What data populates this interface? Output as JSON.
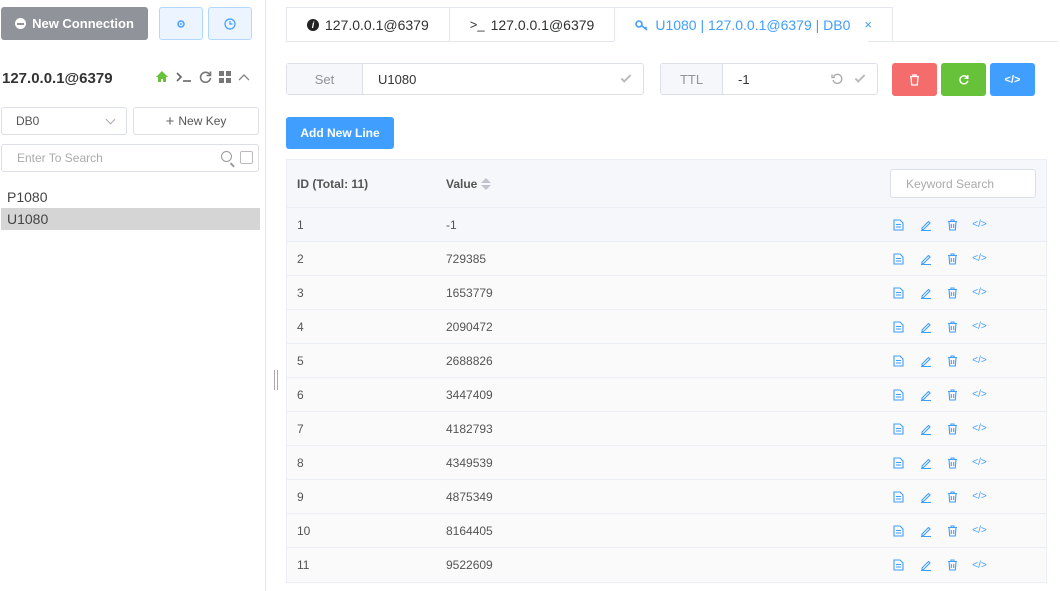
{
  "sidebar": {
    "new_connection_label": "New Connection",
    "server_title": "127.0.0.1@6379",
    "db_select_value": "DB0",
    "new_key_label": "New Key",
    "search_placeholder": "Enter To Search",
    "keys": [
      "P1080",
      "U1080"
    ],
    "active_key": "U1080"
  },
  "tabs": [
    {
      "label": "127.0.0.1@6379",
      "icon": "info-icon"
    },
    {
      "label": "127.0.0.1@6379",
      "icon": "terminal-icon"
    },
    {
      "label": "U1080 | 127.0.0.1@6379 | DB0",
      "icon": "key-icon",
      "active": true
    }
  ],
  "key_header": {
    "type_label": "Set",
    "key_name": "U1080",
    "ttl_label": "TTL",
    "ttl_value": "-1"
  },
  "add_line_label": "Add New Line",
  "table": {
    "col_id": "ID (Total: 11)",
    "col_value": "Value",
    "keyword_placeholder": "Keyword Search",
    "rows": [
      {
        "id": "1",
        "value": "-1"
      },
      {
        "id": "2",
        "value": "729385"
      },
      {
        "id": "3",
        "value": "1653779"
      },
      {
        "id": "4",
        "value": "2090472"
      },
      {
        "id": "5",
        "value": "2688826"
      },
      {
        "id": "6",
        "value": "3447409"
      },
      {
        "id": "7",
        "value": "4182793"
      },
      {
        "id": "8",
        "value": "4349539"
      },
      {
        "id": "9",
        "value": "4875349"
      },
      {
        "id": "10",
        "value": "8164405"
      },
      {
        "id": "11",
        "value": "9522609"
      }
    ]
  },
  "colors": {
    "primary": "#409eff",
    "danger": "#f56c6c",
    "success": "#67c23a",
    "gray": "#909399"
  }
}
